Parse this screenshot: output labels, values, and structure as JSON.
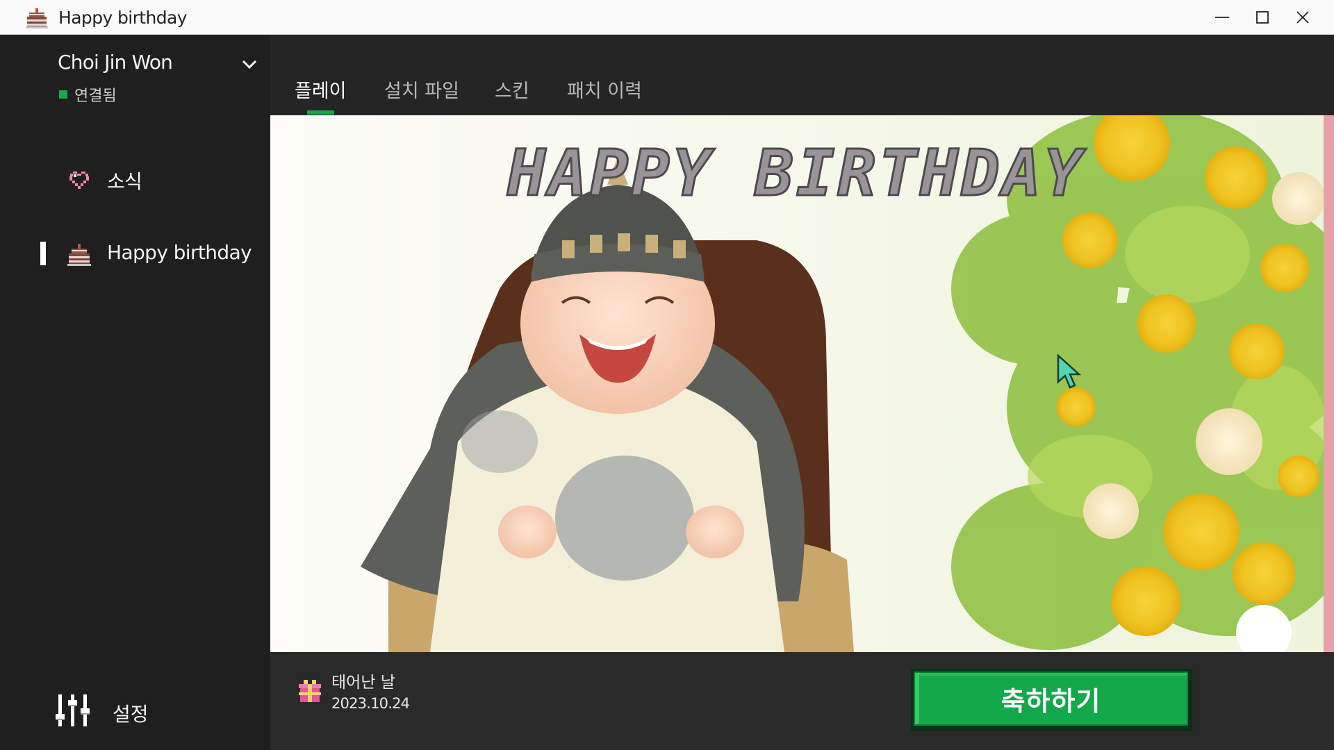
{
  "window": {
    "title": "Happy birthday",
    "app_icon": "cake-icon",
    "controls": [
      "minimize-icon",
      "maximize-icon",
      "close-icon"
    ]
  },
  "sidebar": {
    "account": {
      "name": "Choi Jin Won",
      "status": "연결됨",
      "status_color": "#13a84a"
    },
    "items": [
      {
        "label": "소식",
        "icon": "heart-icon",
        "selected": false
      },
      {
        "label": "Happy birthday",
        "icon": "cake-icon",
        "selected": true
      }
    ],
    "settings": {
      "label": "설정",
      "icon": "sliders-icon"
    }
  },
  "tabs": [
    {
      "label": "플레이",
      "active": true
    },
    {
      "label": "설치 파일",
      "active": false
    },
    {
      "label": "스킨",
      "active": false
    },
    {
      "label": "패치 이력",
      "active": false
    }
  ],
  "banner": {
    "title_text": "HAPPY BIRTHDAY",
    "image": "photo of a laughing baby in traditional hanbok with flowers"
  },
  "info": {
    "icon": "gift-icon",
    "label": "태어난 날",
    "date": "2023.10.24"
  },
  "action": {
    "label": "축하하기"
  },
  "colors": {
    "accent": "#13a84a",
    "sidebar": "#1f1f1f",
    "main": "#2a2a2a"
  }
}
